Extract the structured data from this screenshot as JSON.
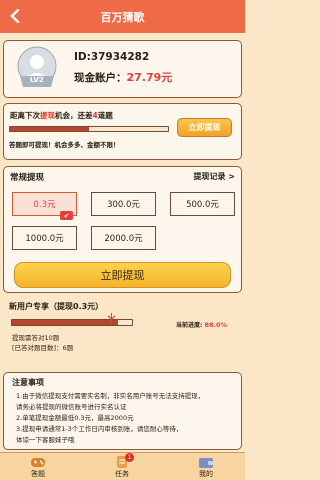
{
  "header": {
    "title": "百万猜歌",
    "back_icon": "chevron-left-icon"
  },
  "profile": {
    "avatar_badge": "LV2",
    "id_text": "ID:37934282",
    "cash_label": "现金账户：",
    "cash_amount": "27.79元"
  },
  "next_withdraw": {
    "prefix": "距离下次",
    "highlight": "提现",
    "middle": "机会，还差",
    "count": "4",
    "suffix": "道题",
    "progress": 0.5,
    "tip": "答题即可提现！机会多多、金额不限！",
    "button_label": "立即提现"
  },
  "regular": {
    "title": "常规提现",
    "record_link": "提现记录 >",
    "options": [
      "0.3元",
      "300.0元",
      "500.0元",
      "1000.0元",
      "2000.0元"
    ],
    "selected_index": 0,
    "button_label": "立即提现"
  },
  "new_user": {
    "title": "新用户专享（提现0.3元）",
    "progress": 0.88,
    "progress_label": "当前进度:",
    "progress_value": "88.0%",
    "line1": "提现需答对10题",
    "line2": "[已答对题目数]：6题"
  },
  "notes": {
    "title": "注意事项",
    "items": [
      "1.由于微信提现支付需要实名制，非实名用户账号无法支持提现，",
      "请务必将提现的微信账号进行实名认证",
      "2.单笔提现金额最低0.3元，最高2000元",
      "3.提现申请通常1-3个工作日内审核到账，请您耐心等待，",
      "体谅一下客服妹子哦"
    ]
  },
  "tabs": [
    {
      "label": "答题",
      "icon": "gamepad-icon"
    },
    {
      "label": "任务",
      "icon": "task-icon",
      "badge": "1"
    },
    {
      "label": "我的",
      "icon": "wallet-icon"
    }
  ],
  "colors": {
    "header": "#ef6a47",
    "accent_red": "#e0413c",
    "button_yellow": "#f4b529",
    "page_bg": "#fbe6c8"
  }
}
